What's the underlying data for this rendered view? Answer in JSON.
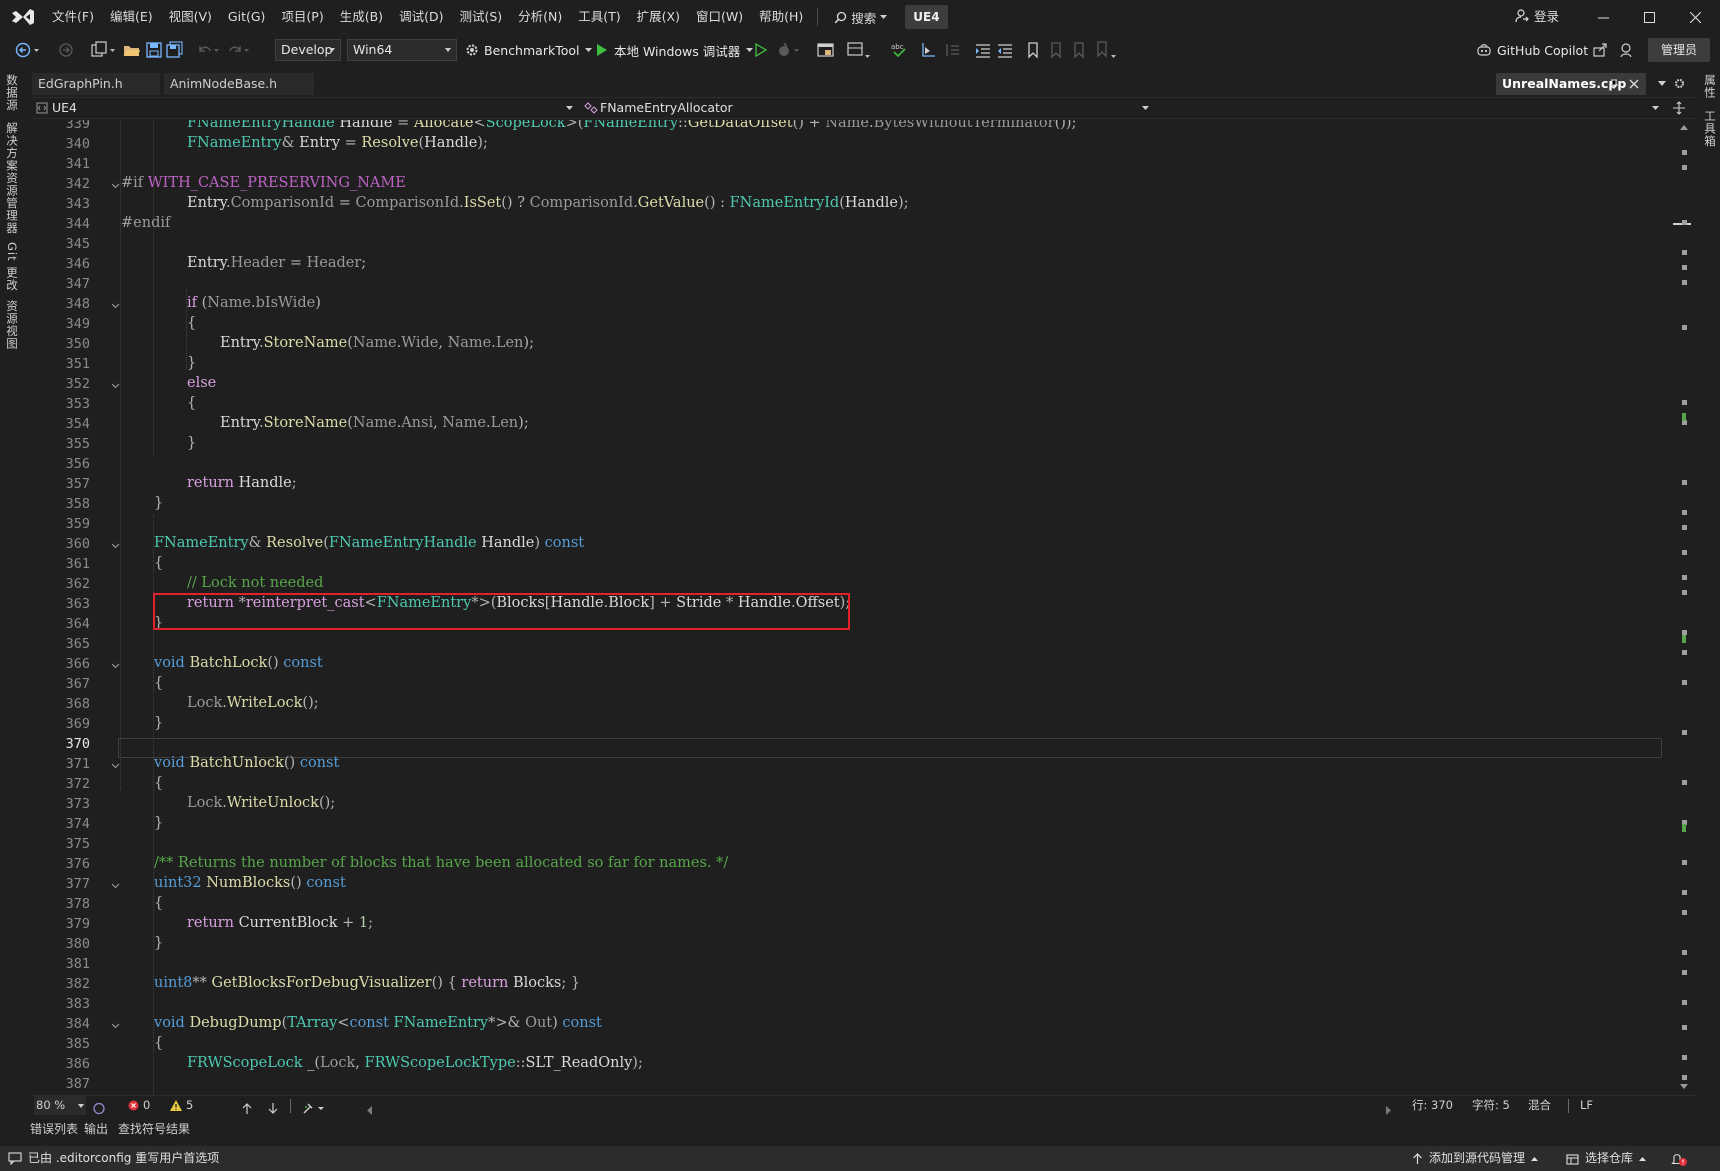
{
  "menubar": {
    "items": [
      "文件(F)",
      "编辑(E)",
      "视图(V)",
      "Git(G)",
      "项目(P)",
      "生成(B)",
      "调试(D)",
      "测试(S)",
      "分析(N)",
      "工具(T)",
      "扩展(X)",
      "窗口(W)",
      "帮助(H)"
    ],
    "search_label": "搜索",
    "solution_name": "UE4",
    "login_label": "登录"
  },
  "toolbar": {
    "config": "Develop",
    "platform": "Win64",
    "startup_project": "BenchmarkTool",
    "debugger_label": "本地 Windows 调试器",
    "copilot_label": "GitHub Copilot",
    "admin_label": "管理员"
  },
  "left_strip": [
    "数据源",
    "解决方案资源管理器",
    "Git 更改",
    "资源视图"
  ],
  "right_strip": [
    "属性",
    "工具箱"
  ],
  "tabs": [
    {
      "label": "EdGraphPin.h",
      "active": false
    },
    {
      "label": "AnimNodeBase.h",
      "active": false
    },
    {
      "label": "UnrealNames.cpp",
      "active": true
    }
  ],
  "navbar": {
    "project": "UE4",
    "scope": "FNameEntryAllocator"
  },
  "editor": {
    "current_line": 370,
    "highlighted_line": 363,
    "lines": [
      {
        "n": "339",
        "code": "FNameEntryHandle Handle = Allocate<ScopeLock>(FNameEntry::GetDataOffset() + Name.BytesWithoutTerminator());"
      },
      {
        "n": "340",
        "code": "FNameEntry& Entry = Resolve(Handle);"
      },
      {
        "n": "341",
        "code": ""
      },
      {
        "n": "342",
        "code": "#if WITH_CASE_PRESERVING_NAME"
      },
      {
        "n": "343",
        "code": "Entry.ComparisonId = ComparisonId.IsSet() ? ComparisonId.GetValue() : FNameEntryId(Handle);"
      },
      {
        "n": "344",
        "code": "#endif"
      },
      {
        "n": "345",
        "code": ""
      },
      {
        "n": "346",
        "code": "Entry.Header = Header;"
      },
      {
        "n": "347",
        "code": ""
      },
      {
        "n": "348",
        "code": "if (Name.bIsWide)"
      },
      {
        "n": "349",
        "code": "{"
      },
      {
        "n": "350",
        "code": "Entry.StoreName(Name.Wide, Name.Len);"
      },
      {
        "n": "351",
        "code": "}"
      },
      {
        "n": "352",
        "code": "else"
      },
      {
        "n": "353",
        "code": "{"
      },
      {
        "n": "354",
        "code": "Entry.StoreName(Name.Ansi, Name.Len);"
      },
      {
        "n": "355",
        "code": "}"
      },
      {
        "n": "356",
        "code": ""
      },
      {
        "n": "357",
        "code": "return Handle;"
      },
      {
        "n": "358",
        "code": "}"
      },
      {
        "n": "359",
        "code": ""
      },
      {
        "n": "360",
        "code": "FNameEntry& Resolve(FNameEntryHandle Handle) const"
      },
      {
        "n": "361",
        "code": "{"
      },
      {
        "n": "362",
        "code": "// Lock not needed"
      },
      {
        "n": "363",
        "code": "return *reinterpret_cast<FNameEntry*>(Blocks[Handle.Block] + Stride * Handle.Offset);"
      },
      {
        "n": "364",
        "code": "}"
      },
      {
        "n": "365",
        "code": ""
      },
      {
        "n": "366",
        "code": "void BatchLock() const"
      },
      {
        "n": "367",
        "code": "{"
      },
      {
        "n": "368",
        "code": "Lock.WriteLock();"
      },
      {
        "n": "369",
        "code": "}"
      },
      {
        "n": "370",
        "code": ""
      },
      {
        "n": "371",
        "code": "void BatchUnlock() const"
      },
      {
        "n": "372",
        "code": "{"
      },
      {
        "n": "373",
        "code": "Lock.WriteUnlock();"
      },
      {
        "n": "374",
        "code": "}"
      },
      {
        "n": "375",
        "code": ""
      },
      {
        "n": "376",
        "code": "/** Returns the number of blocks that have been allocated so far for names. */"
      },
      {
        "n": "377",
        "code": "uint32 NumBlocks() const"
      },
      {
        "n": "378",
        "code": "{"
      },
      {
        "n": "379",
        "code": "return CurrentBlock + 1;"
      },
      {
        "n": "380",
        "code": "}"
      },
      {
        "n": "381",
        "code": ""
      },
      {
        "n": "382",
        "code": "uint8** GetBlocksForDebugVisualizer() { return Blocks; }"
      },
      {
        "n": "383",
        "code": ""
      },
      {
        "n": "384",
        "code": "void DebugDump(TArray<const FNameEntry*>& Out) const"
      },
      {
        "n": "385",
        "code": "{"
      },
      {
        "n": "386",
        "code": "FRWScopeLock _(Lock, FRWScopeLockType::SLT_ReadOnly);"
      },
      {
        "n": "387",
        "code": ""
      }
    ]
  },
  "editor_status": {
    "zoom": "80 %",
    "errors": "0",
    "warnings": "5",
    "line": "行: 370",
    "col": "字符: 5",
    "indent": "混合",
    "eol": "LF"
  },
  "panel_tabs": [
    "错误列表",
    "输出",
    "查找符号结果"
  ],
  "statusbar": {
    "message": "已由 .editorconfig 重写用户首选项",
    "source_control": "添加到源代码管理",
    "repo": "选择仓库"
  },
  "colors": {
    "highlight_box": "#e0222a",
    "keyword": "#569cd6",
    "type": "#4ec9b0",
    "function": "#dcdcaa",
    "comment": "#57a64a"
  }
}
